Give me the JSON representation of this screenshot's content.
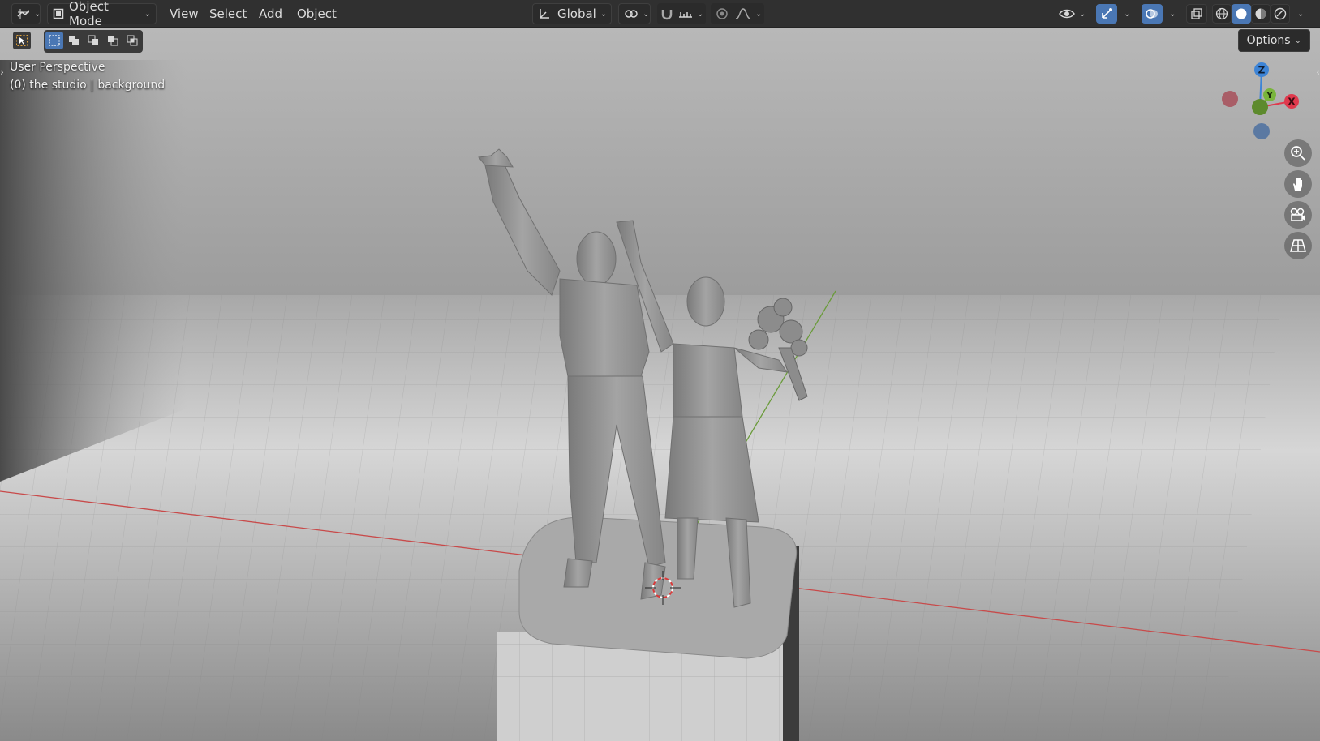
{
  "header": {
    "editor_type_icon": "editor-type-3d-viewport-icon",
    "mode_label": "Object Mode",
    "menus": [
      "View",
      "Select",
      "Add",
      "Object"
    ],
    "transform_orientation": "Global",
    "options_label": "Options"
  },
  "viewport": {
    "view_name": "User Perspective",
    "collection_prefix": "(0) the studio",
    "active_object": "background"
  },
  "gizmo": {
    "z_label": "Z",
    "y_label": "Y",
    "x_label": "X",
    "colors": {
      "x": "#e0394d",
      "y": "#79b53b",
      "z": "#3d84d6"
    }
  },
  "colors": {
    "accent": "#4a77b4",
    "header_bg": "#303030",
    "x_axis": "#c84a4a",
    "y_axis": "#6a9b3a"
  },
  "nav_icons": [
    "zoom-icon",
    "pan-hand-icon",
    "camera-icon",
    "ortho-grid-icon"
  ]
}
